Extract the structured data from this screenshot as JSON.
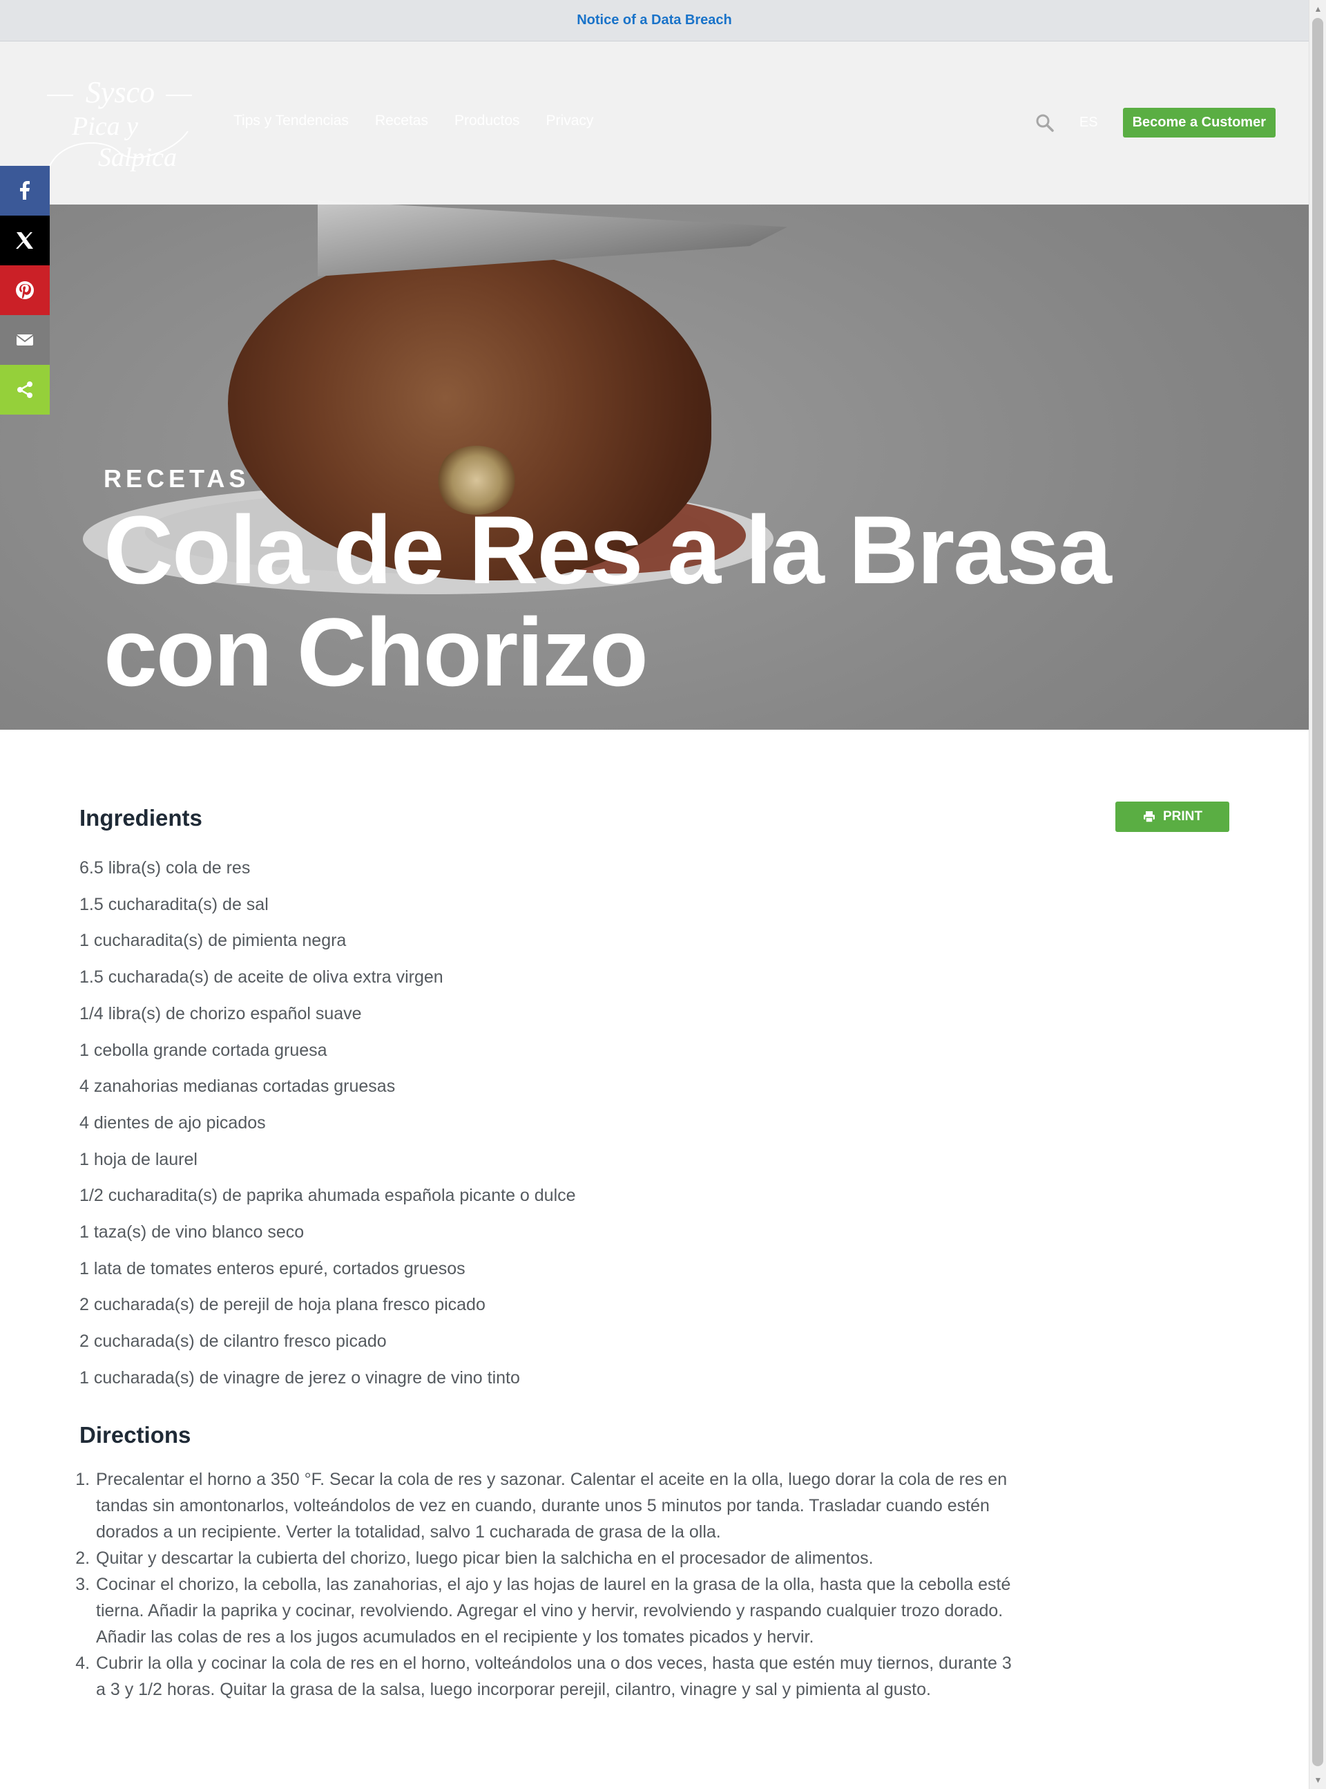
{
  "notice": {
    "text": "Notice of a Data Breach"
  },
  "header": {
    "logo": {
      "brand": "Sysco",
      "line1": "Pica y",
      "line2": "Salpica"
    },
    "nav": [
      "Tips y Tendencias",
      "Recetas",
      "Productos",
      "Privacy"
    ],
    "language": "ES",
    "cta_label": "Become a Customer",
    "search_icon": "search-icon"
  },
  "share": [
    "facebook-icon",
    "x-icon",
    "pinterest-icon",
    "email-icon",
    "share-icon"
  ],
  "hero": {
    "kicker": "RECETAS",
    "title": "Cola de Res a la Brasa con Chorizo"
  },
  "ingredients": {
    "title": "Ingredients",
    "print_label": "PRINT",
    "items": [
      "6.5 libra(s) cola de res",
      "1.5 cucharadita(s) de sal",
      "1 cucharadita(s) de pimienta negra",
      "1.5 cucharada(s) de aceite de oliva extra virgen",
      "1/4 libra(s) de chorizo español suave",
      "1 cebolla grande cortada gruesa",
      "4 zanahorias medianas cortadas gruesas",
      "4 dientes de ajo picados",
      "1 hoja de laurel",
      "1/2 cucharadita(s) de paprika ahumada española picante o dulce",
      "1 taza(s) de vino blanco seco",
      "1 lata de tomates enteros epuré, cortados gruesos",
      "2 cucharada(s) de perejil de hoja plana fresco picado",
      "2 cucharada(s) de cilantro fresco picado",
      "1 cucharada(s) de vinagre de jerez o vinagre de vino tinto"
    ]
  },
  "directions": {
    "title": "Directions",
    "steps": [
      "Precalentar el horno a 350 °F. Secar la cola de res y sazonar. Calentar el aceite en la olla, luego dorar la cola de res en tandas sin amontonarlos, volteándolos de vez en cuando, durante unos 5 minutos por tanda. Trasladar cuando estén dorados a un recipiente. Verter la totalidad, salvo 1 cucharada de grasa de la olla.",
      "Quitar y descartar la cubierta del chorizo, luego picar bien la salchicha en el procesador de alimentos.",
      "Cocinar el chorizo, la cebolla, las zanahorias, el ajo y las hojas de laurel en la grasa de la olla, hasta que la cebolla esté tierna. Añadir la paprika y cocinar, revolviendo. Agregar el vino y hervir, revolviendo y raspando cualquier trozo dorado. Añadir las colas de res a los jugos acumulados en el recipiente y los tomates picados y hervir.",
      "Cubrir la olla y cocinar la cola de res en el horno, volteándolos una o dos veces, hasta que estén muy tiernos, durante 3 a 3 y 1/2 horas. Quitar la grasa de la salsa, luego incorporar perejil, cilantro, vinagre y sal y pimienta al gusto."
    ]
  },
  "colors": {
    "accent_green": "#5aae43",
    "notice_link": "#1a73c9",
    "heading": "#1f2a36"
  }
}
